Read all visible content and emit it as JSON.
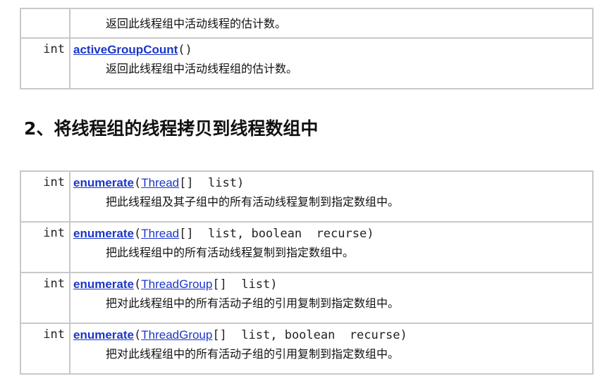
{
  "top_table": {
    "rows": [
      {
        "type": "",
        "method": "",
        "params": "",
        "description": "返回此线程组中活动线程的估计数。"
      },
      {
        "type": "int",
        "method": "activeGroupCount",
        "open": "()",
        "description": "返回此线程组中活动线程组的估计数。"
      }
    ]
  },
  "section_heading": "2、将线程组的线程拷贝到线程数组中",
  "enumerate_table": {
    "rows": [
      {
        "type": "int",
        "method": "enumerate",
        "open": "(",
        "class_link": "Thread",
        "rest": "[]  list)",
        "description": "把此线程组及其子组中的所有活动线程复制到指定数组中。"
      },
      {
        "type": "int",
        "method": "enumerate",
        "open": "(",
        "class_link": "Thread",
        "rest": "[]  list, boolean  recurse)",
        "description": "把此线程组中的所有活动线程复制到指定数组中。"
      },
      {
        "type": "int",
        "method": "enumerate",
        "open": "(",
        "class_link": "ThreadGroup",
        "rest": "[]  list)",
        "description": "把对此线程组中的所有活动子组的引用复制到指定数组中。"
      },
      {
        "type": "int",
        "method": "enumerate",
        "open": "(",
        "class_link": "ThreadGroup",
        "rest": "[]  list, boolean  recurse)",
        "description": "把对此线程组中的所有活动子组的引用复制到指定数组中。"
      }
    ]
  },
  "colors": {
    "link": "#1b36c8",
    "border": "#c8c8c8"
  }
}
